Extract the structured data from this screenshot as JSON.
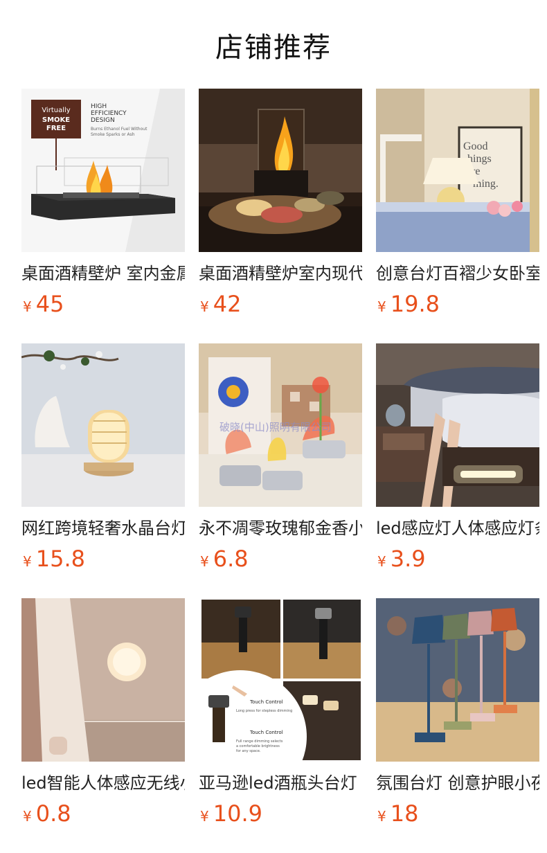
{
  "page": {
    "title": "店铺推荐"
  },
  "products": [
    {
      "name": "桌面酒精壁炉 室内金属无烟生物乙醇壁炉",
      "currency": "¥",
      "price": "45",
      "thumb_text": {
        "sign_l1": "Virtually",
        "sign_l2": "SMOKE",
        "sign_l3": "FREE",
        "h1": "HIGH",
        "h2": "EFFICIENCY",
        "h3": "DESIGN",
        "sub1": "Burns Ethanol Fuel Without",
        "sub2": "Smoke Sparks or Ash"
      }
    },
    {
      "name": "桌面酒精壁炉室内现代简约",
      "currency": "¥",
      "price": "42"
    },
    {
      "name": "创意台灯百褶少女卧室床头灯",
      "currency": "¥",
      "price": "19.8",
      "thumb_text": {
        "p1": "Good",
        "p2": "hings",
        "p3": "re",
        "p4": "ming."
      }
    },
    {
      "name": "网红跨境轻奢水晶台灯卧室",
      "currency": "¥",
      "price": "15.8"
    },
    {
      "name": "永不凋零玫瑰郁金香小夜灯",
      "currency": "¥",
      "price": "6.8",
      "thumb_text": {
        "watermark": "破晓(中山)照明有限公司"
      }
    },
    {
      "name": "led感应灯人体感应灯条",
      "currency": "¥",
      "price": "3.9"
    },
    {
      "name": "led智能人体感应无线小夜灯",
      "currency": "¥",
      "price": "0.8"
    },
    {
      "name": "亚马逊led酒瓶头台灯",
      "currency": "¥",
      "price": "10.9",
      "thumb_text": {
        "t1": "Touch Control",
        "t2": "Long press for stepless dimming",
        "t3": "Touch Control",
        "t4": "Full range dimming selects",
        "t5": "a comfortable brightness",
        "t6": "for any space."
      }
    },
    {
      "name": "氛围台灯 创意护眼小夜灯",
      "currency": "¥",
      "price": "18"
    }
  ]
}
